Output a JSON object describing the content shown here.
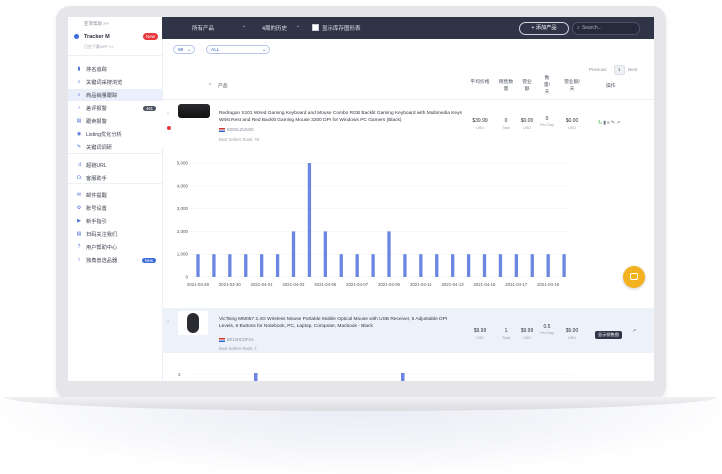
{
  "sidebar": {
    "top_link": "亚菲帮助 >>",
    "user_name": "Tracker M",
    "user_badge": "New",
    "user_sub": "已在下载APP >>",
    "items": [
      {
        "label": "排名追踪",
        "icon": "bar-chart-icon"
      },
      {
        "label": "关键词采搜浏览",
        "icon": "search-icon"
      },
      {
        "label": "商品销量跟踪",
        "icon": "search-icon"
      },
      {
        "label": "差评报警",
        "icon": "bell-icon",
        "count": "461"
      },
      {
        "label": "跟卖报警",
        "icon": "doc-icon"
      },
      {
        "label": "Listing优化分析",
        "icon": "eye-icon"
      },
      {
        "label": "关键词调研",
        "icon": "wrench-icon"
      },
      {
        "label": "超链URL",
        "icon": "shuffle-icon"
      },
      {
        "label": "客服助手",
        "icon": "headset-icon"
      },
      {
        "label": "邮件提醒",
        "icon": "mail-icon"
      },
      {
        "label": "账号设置",
        "icon": "gear-icon"
      },
      {
        "label": "新手指引",
        "icon": "video-icon"
      },
      {
        "label": "扫码关注我们",
        "icon": "doc-icon"
      },
      {
        "label": "用户帮助中心",
        "icon": "help-icon"
      },
      {
        "label": "独角兽选品器",
        "icon": "info-icon",
        "count": "New"
      }
    ]
  },
  "topbar": {
    "product_filter": "所有产品",
    "history_filter": "4周的历史",
    "checkbox_label": "显示库存图形表",
    "add_button": "+ 添加产品",
    "search_placeholder": "Search..."
  },
  "filters": {
    "per_page": "88",
    "category": "ALL"
  },
  "pager": {
    "prev": "Previous",
    "page": "1",
    "next": "Next"
  },
  "table": {
    "headers": {
      "product": "产品",
      "avg_price": "平均价格",
      "sales_qty": "销售数量",
      "revenue": "营业额",
      "days": "数量/天",
      "rev_day": "营业额/天",
      "actions": "操作"
    },
    "rows": [
      {
        "title": "Redragon S101 Wired Gaming Keyboard and Mouse Combo RGB Backlit Gaming Keyboard with Multimedia Keys Wrist Rest and Red Backlit Gaming Mouse 3200 DPI for Windows PC Gamers (Black)",
        "asin": "B00NLZUM36",
        "bsr": "Best Sellers Rank: #3",
        "price": "$39.99",
        "price_unit": "USD",
        "qty": "0",
        "qty_unit": "Total",
        "revenue": "$0.00",
        "revenue_unit": "USD",
        "per_day": "0",
        "per_day_unit": "Per Day",
        "rev_day": "$0.00",
        "rev_day_unit": "USD"
      },
      {
        "title": "VicTsing MM057 2.4G Wireless Mouse Portable Mobile Optical Mouse with USB Receiver, 5 Adjustable DPI Levels, 6 Buttons for Notebook, PC, Laptop, Computer, Macbook - Black",
        "asin": "B013HCOF2A",
        "bsr": "Best Sellers Rank: 1",
        "price": "$9.99",
        "price_unit": "USD",
        "qty": "1",
        "qty_unit": "Total",
        "revenue": "$9.99",
        "revenue_unit": "USD",
        "per_day": "0.5",
        "per_day_unit": "Per Day",
        "rev_day": "$5.00",
        "rev_day_unit": "USD",
        "tooltip": "显示销售图"
      }
    ]
  },
  "chart_data": [
    {
      "type": "bar",
      "y_ticks": [
        "5,000",
        "4,000",
        "3,000",
        "2,000",
        "1,000",
        "0"
      ],
      "ylim": [
        0,
        5000
      ],
      "x_tick_labels": [
        "2021-03-28",
        "2021-03-30",
        "2021-04-01",
        "2021-04-03",
        "2021-04-05",
        "2021-04-07",
        "2021-04-09",
        "2021-04-11",
        "2021-04-13",
        "2021-04-15",
        "2021-04-17",
        "2021-04-19"
      ],
      "values": [
        1000,
        1000,
        1000,
        1000,
        1000,
        1000,
        2000,
        5000,
        2000,
        1000,
        1000,
        1000,
        2000,
        1000,
        1000,
        1000,
        1000,
        1000,
        1000,
        1000,
        1000,
        1000,
        1000,
        1000
      ],
      "color": "#6a86e0"
    },
    {
      "type": "bar",
      "y_ticks": [
        "2"
      ],
      "values_visible": "partial"
    }
  ],
  "chat": {
    "icon": "chat-icon"
  }
}
